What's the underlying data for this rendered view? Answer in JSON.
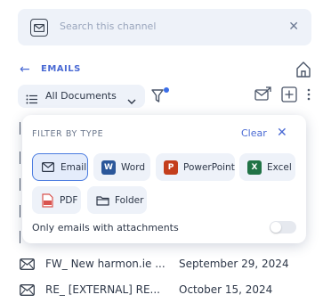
{
  "search": {
    "placeholder": "Search this channel"
  },
  "nav": {
    "section_label": "EMAILS"
  },
  "toolbar": {
    "documents_select": "All Documents"
  },
  "filter_popover": {
    "title": "FILTER BY TYPE",
    "clear_label": "Clear",
    "types": [
      {
        "label": "Email",
        "icon": "mail-icon",
        "active": true
      },
      {
        "label": "Word",
        "icon": "word-icon",
        "active": false
      },
      {
        "label": "PowerPoint",
        "icon": "powerpoint-icon",
        "active": false
      },
      {
        "label": "Excel",
        "icon": "excel-icon",
        "active": false
      },
      {
        "label": "PDF",
        "icon": "pdf-icon",
        "active": false
      },
      {
        "label": "Folder",
        "icon": "folder-icon",
        "active": false
      }
    ],
    "attachments_label": "Only emails with attachments",
    "attachments_only": false
  },
  "list": {
    "items": [
      {
        "subject": "FW_ New harmon.ie ...",
        "date": "September 29, 2024"
      },
      {
        "subject": "RE_ [EXTERNAL] RE...",
        "date": "October 15, 2024"
      }
    ]
  },
  "colors": {
    "accent": "#4a6ad4",
    "chip_bg": "#eef2f9",
    "word": "#2b579a",
    "powerpoint": "#c43e1c",
    "excel": "#217346",
    "pdf": "#d9534f"
  }
}
